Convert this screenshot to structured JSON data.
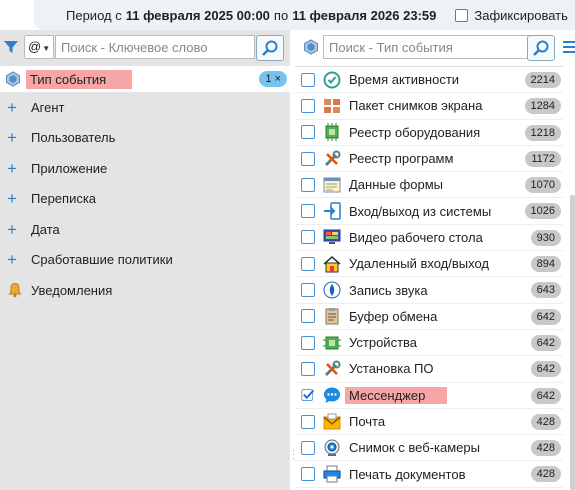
{
  "topbar": {
    "period_prefix": "Период с",
    "from": "11 февраля 2025 00:00",
    "to_word": "по",
    "to": "11 февраля 2026 23:59",
    "fix_label": "Зафиксировать"
  },
  "left": {
    "at_value": "@",
    "keyword_placeholder": "Поиск - Ключевое слово",
    "selected": {
      "label": "Тип события",
      "count": "1",
      "remove": "×"
    },
    "items": [
      "Агент",
      "Пользователь",
      "Приложение",
      "Переписка",
      "Дата",
      "Сработавшие политики"
    ],
    "notifications": "Уведомления"
  },
  "right": {
    "type_placeholder": "Поиск - Тип события",
    "events": [
      {
        "label": "Время активности",
        "count": "2214",
        "icon": "activity-clock-icon",
        "checked": false
      },
      {
        "label": "Пакет снимков экрана",
        "count": "1284",
        "icon": "screenshots-icon",
        "checked": false
      },
      {
        "label": "Реестр оборудования",
        "count": "1218",
        "icon": "hardware-chip-icon",
        "checked": false
      },
      {
        "label": "Реестр программ",
        "count": "1172",
        "icon": "software-tools-icon",
        "checked": false
      },
      {
        "label": "Данные формы",
        "count": "1070",
        "icon": "form-data-icon",
        "checked": false
      },
      {
        "label": "Вход/выход из системы",
        "count": "1026",
        "icon": "login-icon",
        "checked": false
      },
      {
        "label": "Видео рабочего стола",
        "count": "930",
        "icon": "desktop-video-icon",
        "checked": false
      },
      {
        "label": "Удаленный вход/выход",
        "count": "894",
        "icon": "remote-login-icon",
        "checked": false
      },
      {
        "label": "Запись звука",
        "count": "643",
        "icon": "sound-record-icon",
        "checked": false
      },
      {
        "label": "Буфер обмена",
        "count": "642",
        "icon": "clipboard-icon",
        "checked": false
      },
      {
        "label": "Устройства",
        "count": "642",
        "icon": "devices-chip-icon",
        "checked": false
      },
      {
        "label": "Установка ПО",
        "count": "642",
        "icon": "install-tools-icon",
        "checked": false
      },
      {
        "label": "Мессенджер",
        "count": "642",
        "icon": "messenger-icon",
        "checked": true
      },
      {
        "label": "Почта",
        "count": "428",
        "icon": "mail-icon",
        "checked": false
      },
      {
        "label": "Снимок с веб-камеры",
        "count": "428",
        "icon": "webcam-icon",
        "checked": false
      },
      {
        "label": "Печать документов",
        "count": "428",
        "icon": "printer-icon",
        "checked": false
      }
    ]
  },
  "colors": {
    "accent": "#2a7fcf",
    "highlight": "#f6a6a6",
    "badge_blue": "#76c3f2",
    "badge_gray": "#c8c8c8"
  }
}
